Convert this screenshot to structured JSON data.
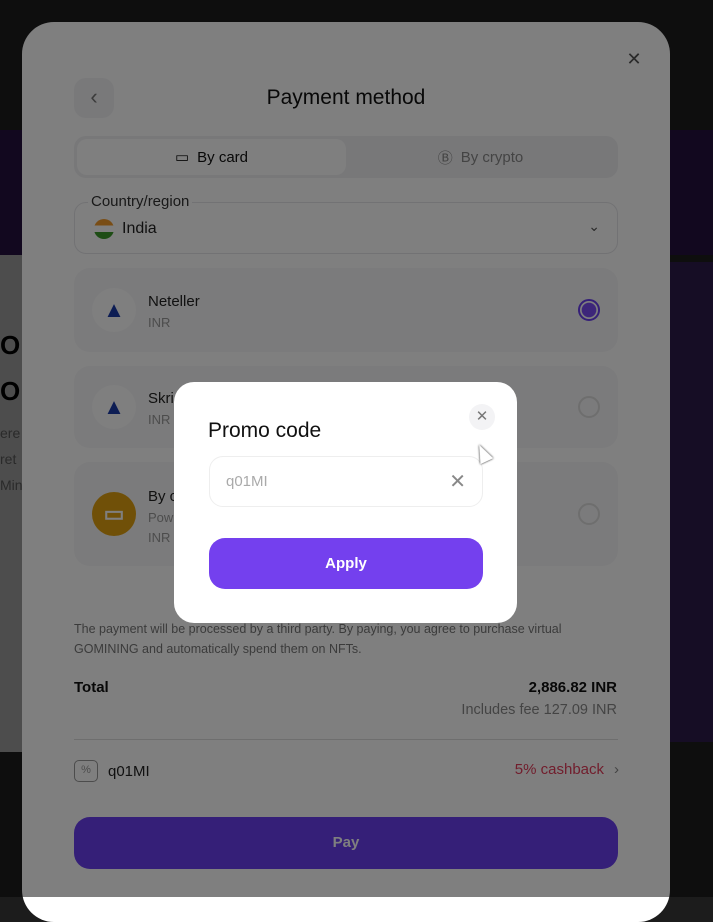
{
  "background": {
    "left_texts": [
      "O",
      "O"
    ],
    "left_small": [
      "ere",
      "ret",
      "Min"
    ]
  },
  "sheet": {
    "title": "Payment method",
    "back_icon": "chevron-left-icon",
    "close_icon": "close-icon",
    "tabs": [
      {
        "label": "By card",
        "icon": "card-icon",
        "active": true
      },
      {
        "label": "By crypto",
        "icon": "bitcoin-icon",
        "active": false
      }
    ],
    "country": {
      "label": "Country/region",
      "value": "India"
    },
    "methods": [
      {
        "name": "Neteller",
        "sub": "INR",
        "selected": true
      },
      {
        "name": "Skri",
        "sub": "INR",
        "selected": false
      },
      {
        "name": "By c",
        "sub": "Pow",
        "sub2": "INR",
        "selected": false
      }
    ],
    "notice": "The payment will be processed by a third party. By paying, you agree to purchase virtual GOMINING and automatically spend them on NFTs.",
    "total_label": "Total",
    "total_amount": "2,886.82 INR",
    "fee": "Includes fee 127.09 INR",
    "promo_code": "q01MI",
    "cashback": "5% cashback",
    "pay_label": "Pay",
    "accent": "#6a3ff0",
    "cashback_color": "#e33c5a"
  },
  "modal": {
    "title": "Promo code",
    "input_value": "q01MI",
    "apply_label": "Apply"
  }
}
